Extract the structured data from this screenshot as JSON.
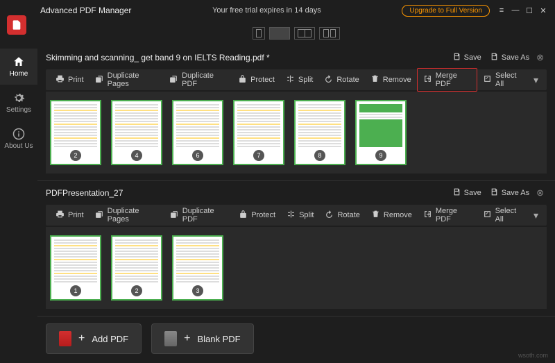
{
  "app": {
    "title": "Advanced PDF Manager",
    "trial_text": "Your free trial expires in 14 days",
    "upgrade_label": "Upgrade to Full Version"
  },
  "nav": {
    "home": "Home",
    "settings": "Settings",
    "about": "About Us"
  },
  "header_actions": {
    "save": "Save",
    "save_as": "Save As"
  },
  "toolbar": {
    "print": "Print",
    "dup_pages": "Duplicate Pages",
    "dup_pdf": "Duplicate PDF",
    "protect": "Protect",
    "split": "Split",
    "rotate": "Rotate",
    "remove": "Remove",
    "merge": "Merge PDF",
    "select_all": "Select All"
  },
  "docs": [
    {
      "filename": "Skimming and scanning_ get band 9 on IELTS Reading.pdf",
      "modified": true,
      "highlight_merge": true,
      "pages": [
        {
          "num": 2
        },
        {
          "num": 4
        },
        {
          "num": 6
        },
        {
          "num": 7
        },
        {
          "num": 8
        },
        {
          "num": 9,
          "green": true
        }
      ]
    },
    {
      "filename": "PDFPresentation_27",
      "modified": false,
      "highlight_merge": false,
      "pages": [
        {
          "num": 1
        },
        {
          "num": 2
        },
        {
          "num": 3
        }
      ]
    }
  ],
  "bottom": {
    "add_pdf": "Add PDF",
    "blank_pdf": "Blank PDF"
  },
  "watermark": "wsoth.com"
}
